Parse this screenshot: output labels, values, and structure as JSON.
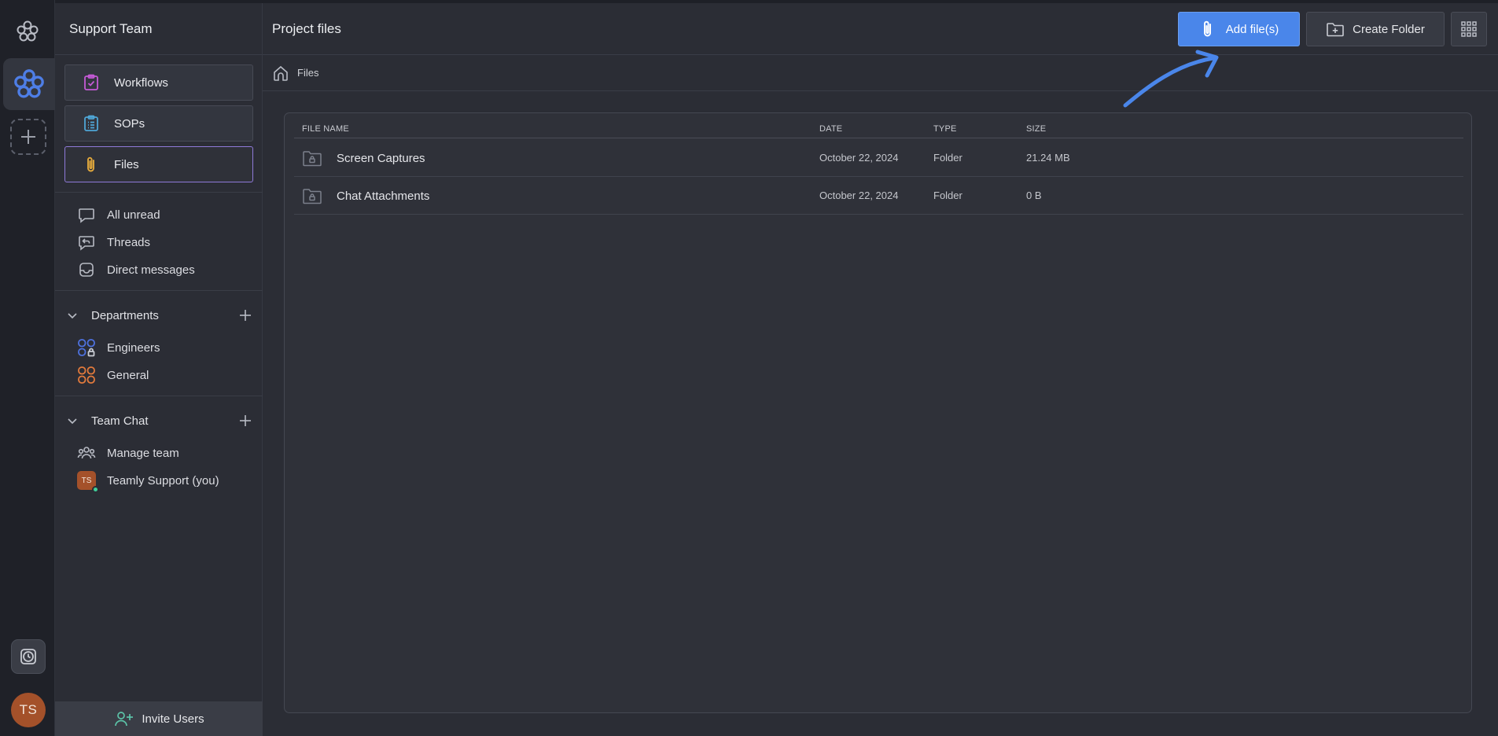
{
  "sidebar": {
    "team_name": "Support Team",
    "nav_cards": [
      {
        "label": "Workflows"
      },
      {
        "label": "SOPs"
      },
      {
        "label": "Files"
      }
    ],
    "quick_items": [
      {
        "label": "All unread"
      },
      {
        "label": "Threads"
      },
      {
        "label": "Direct messages"
      }
    ],
    "departments": {
      "title": "Departments",
      "items": [
        {
          "label": "Engineers"
        },
        {
          "label": "General"
        }
      ]
    },
    "team_chat": {
      "title": "Team Chat",
      "items": [
        {
          "label": "Manage team"
        },
        {
          "label": "Teamly Support (you)",
          "avatar": "TS"
        }
      ]
    },
    "invite_label": "Invite Users"
  },
  "rail": {
    "user_initials": "TS"
  },
  "main": {
    "title": "Project files",
    "add_files_label": "Add file(s)",
    "create_folder_label": "Create Folder",
    "breadcrumb": "Files",
    "table": {
      "columns": [
        "FILE NAME",
        "DATE",
        "TYPE",
        "SIZE"
      ],
      "rows": [
        {
          "name": "Screen Captures",
          "date": "October 22, 2024",
          "type": "Folder",
          "size": "21.24 MB"
        },
        {
          "name": "Chat Attachments",
          "date": "October 22, 2024",
          "type": "Folder",
          "size": "0 B"
        }
      ]
    }
  },
  "colors": {
    "accent_blue": "#4a86ea",
    "active_border": "#8f7ad9",
    "avatar": "#a4512a",
    "online": "#3fcf9a"
  }
}
